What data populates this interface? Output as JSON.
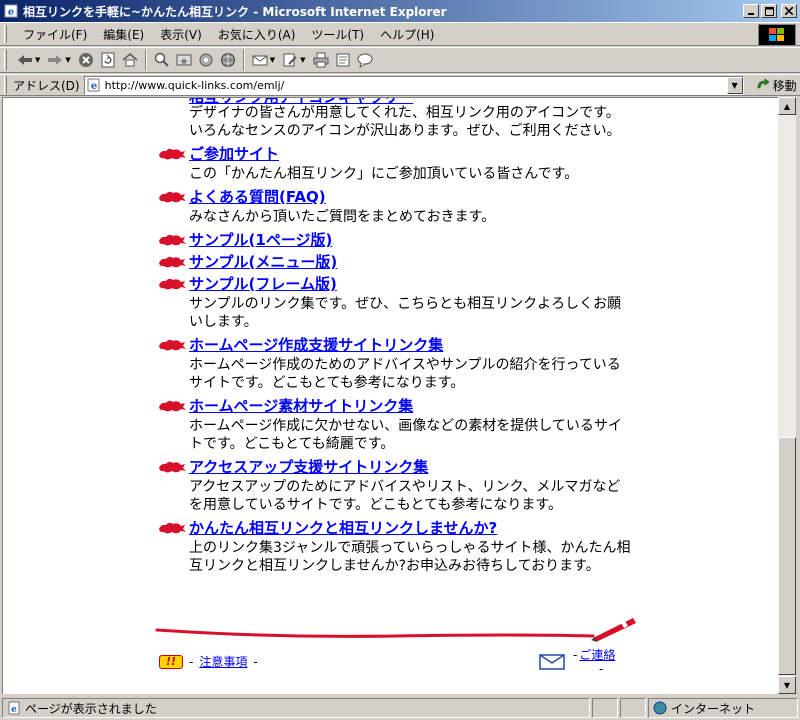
{
  "window": {
    "title": "相互リンクを手軽に~かんたん相互リンク - Microsoft Internet Explorer"
  },
  "menu": [
    "ファイル(F)",
    "編集(E)",
    "表示(V)",
    "お気に入り(A)",
    "ツール(T)",
    "ヘルプ(H)"
  ],
  "toolbar": {
    "icons": [
      "back-icon",
      "forward-icon",
      "stop-icon",
      "refresh-icon",
      "home-icon",
      "search-icon",
      "favorites-icon",
      "media-icon",
      "history-icon",
      "mail-icon",
      "edit-icon",
      "print-icon",
      "discuss-icon",
      "messenger-icon"
    ]
  },
  "address": {
    "label": "アドレス(D)",
    "url": "http://www.quick-links.com/emlj/",
    "go_label": "移動"
  },
  "content": {
    "partial_top_link": "相互リンク用アイコンギャラリー",
    "entries": [
      {
        "link": "",
        "desc": "デザイナの皆さんが用意してくれた、相互リンク用のアイコンです。いろんなセンスのアイコンが沢山あります。ぜひ、ご利用ください。",
        "no_bullet": true
      },
      {
        "link": "ご参加サイト",
        "desc": "この「かんたん相互リンク」にご参加頂いている皆さんです。"
      },
      {
        "link": "よくある質問(FAQ)",
        "desc": "みなさんから頂いたご質問をまとめておきます。"
      },
      {
        "link": "サンプル(1ページ版)",
        "desc": ""
      },
      {
        "link": "サンプル(メニュー版)",
        "desc": ""
      },
      {
        "link": "サンプル(フレーム版)",
        "desc": "サンプルのリンク集です。ぜひ、こちらとも相互リンクよろしくお願いします。"
      },
      {
        "link": "ホームページ作成支援サイトリンク集",
        "desc": "ホームページ作成のためのアドバイスやサンプルの紹介を行っているサイトです。どこもとても参考になります。"
      },
      {
        "link": "ホームページ素材サイトリンク集",
        "desc": "ホームページ作成に欠かせない、画像などの素材を提供しているサイトです。どこもとても綺麗です。"
      },
      {
        "link": "アクセスアップ支援サイトリンク集",
        "desc": "アクセスアップのためにアドバイスやリスト、リンク、メルマガなどを用意しているサイトです。どこもとても参考になります。"
      },
      {
        "link": "かんたん相互リンクと相互リンクしませんか?",
        "desc": "上のリンク集3ジャンルで頑張っていらっしゃるサイト様、かんたん相互リンクと相互リンクしませんか?お申込みお待ちしております。"
      }
    ],
    "footer": {
      "warn_badge": "!!",
      "notice_prefix": "-",
      "notice_link": "注意事項",
      "notice_suffix": "-",
      "contact_prefix": "-",
      "contact_link": "ご連絡",
      "contact_suffix": "-"
    }
  },
  "status": {
    "text": "ページが表示されました",
    "zone": "インターネット"
  },
  "colors": {
    "link": "#0000ff",
    "bullet": "#d8102a",
    "titlebar": "#0a246a"
  }
}
